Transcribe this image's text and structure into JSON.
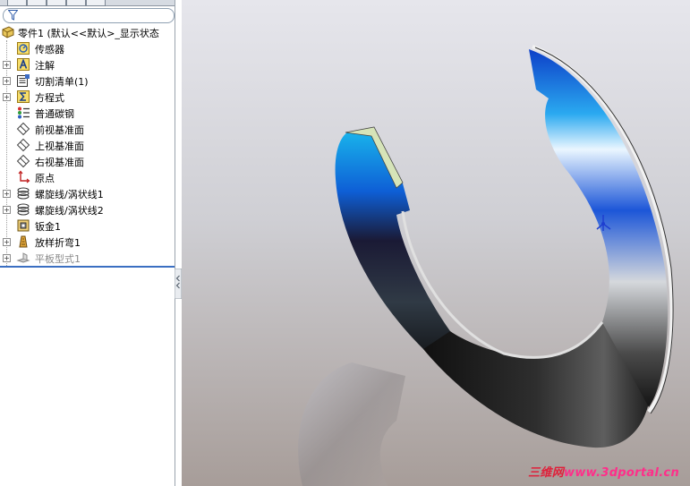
{
  "tree": {
    "root_label": "零件1  (默认<<默认>_显示状态",
    "items": [
      {
        "label": "传感器",
        "icon": "sensor-icon",
        "expandable": false
      },
      {
        "label": "注解",
        "icon": "annotation-icon",
        "expandable": true
      },
      {
        "label": "切割清单(1)",
        "icon": "cut-list-icon",
        "expandable": true
      },
      {
        "label": "方程式",
        "icon": "equation-icon",
        "expandable": true
      },
      {
        "label": "普通碳钢",
        "icon": "material-icon",
        "expandable": false
      },
      {
        "label": "前视基准面",
        "icon": "plane-icon",
        "expandable": false
      },
      {
        "label": "上视基准面",
        "icon": "plane-icon",
        "expandable": false
      },
      {
        "label": "右视基准面",
        "icon": "plane-icon",
        "expandable": false
      },
      {
        "label": "原点",
        "icon": "origin-icon",
        "expandable": false
      },
      {
        "label": "螺旋线/涡状线1",
        "icon": "helix-icon",
        "expandable": true
      },
      {
        "label": "螺旋线/涡状线2",
        "icon": "helix-icon",
        "expandable": true
      },
      {
        "label": "钣金1",
        "icon": "sheet-metal-icon",
        "expandable": false
      },
      {
        "label": "放样折弯1",
        "icon": "lofted-bend-icon",
        "expandable": true
      },
      {
        "label": "平板型式1",
        "icon": "flat-pattern-icon",
        "expandable": true,
        "suppressed": true
      }
    ]
  },
  "watermark": {
    "part1": "三维网",
    "part2": "www.3dportal.cn"
  },
  "colors": {
    "accent": "#3b6fc2",
    "watermark": "#e0203a"
  }
}
